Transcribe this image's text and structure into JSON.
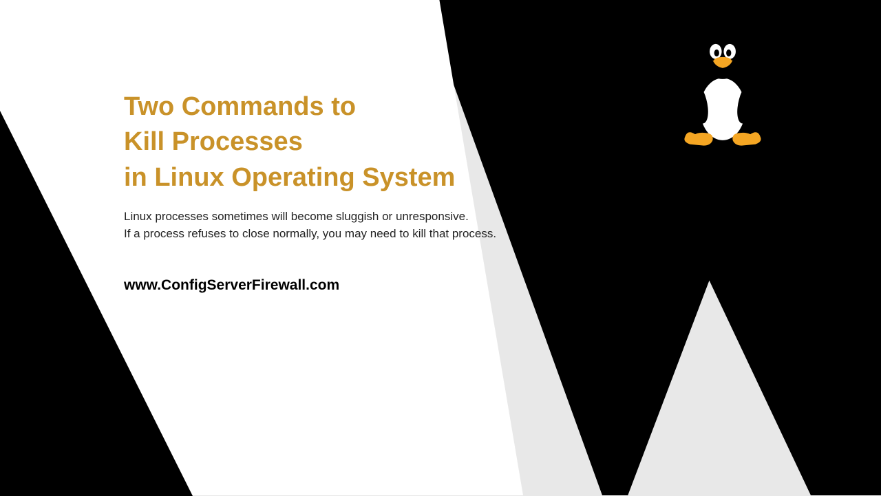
{
  "title": {
    "line1": "Two Commands to",
    "line2": "Kill Processes",
    "line3": "in Linux Operating System"
  },
  "description": {
    "line1": "Linux processes sometimes will become sluggish or unresponsive.",
    "line2": "If a process refuses to close normally, you may need to kill that process."
  },
  "website": "www.ConfigServerFirewall.com",
  "icon": "tux-penguin",
  "colors": {
    "title": "#c99229",
    "background_dark": "#000000",
    "background_light": "#e8e8e8",
    "panel": "#ffffff"
  }
}
